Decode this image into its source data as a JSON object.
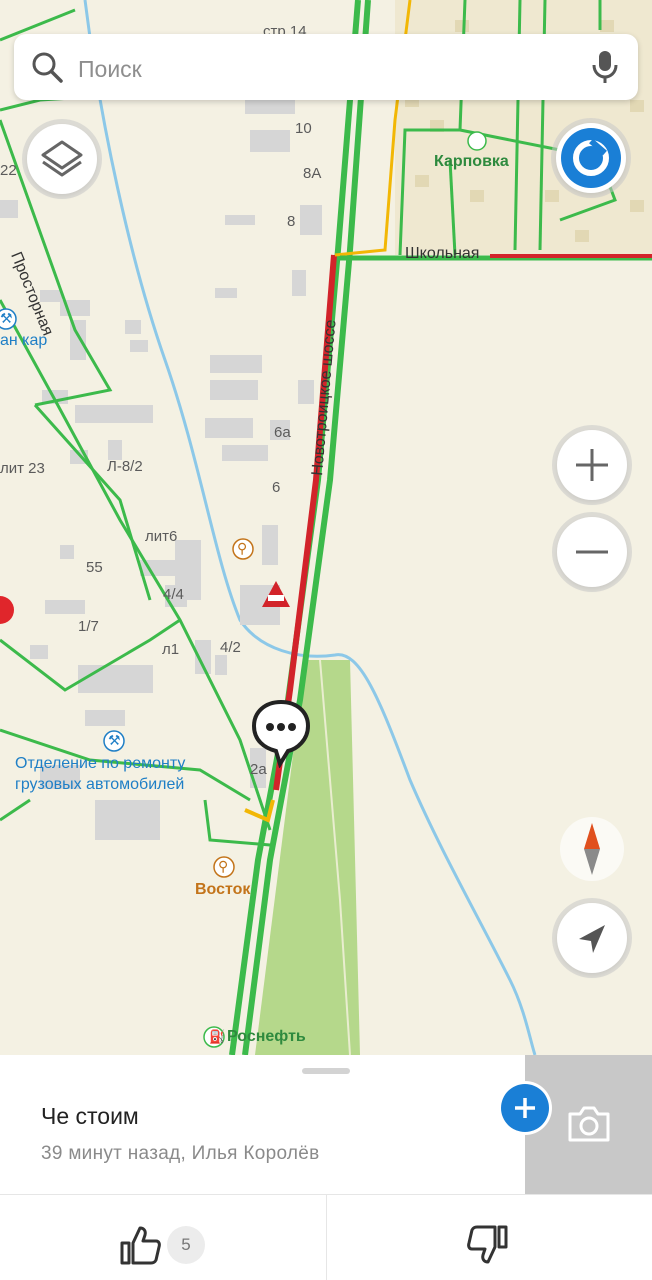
{
  "search": {
    "placeholder": "Поиск"
  },
  "map": {
    "labels": {
      "str14": "стр 14",
      "b10": "10",
      "b8a": "8А",
      "b8": "8",
      "b22": "22",
      "prostornaya": "Просторная",
      "karpovka": "Карповка",
      "shkolnaya": "Школьная",
      "novotroitskoe": "Новотроицкое шоссе",
      "pan_kar": "ан кар",
      "b6a": "6а",
      "b6": "6",
      "lit23": "лит 23",
      "l82": "Л-8/2",
      "lit6": "лит6",
      "b55": "55",
      "b44": "4/4",
      "b17": "1/7",
      "l1": "л1",
      "b42": "4/2",
      "b2a": "2а",
      "repair_line1": "Отделение по ремонту",
      "repair_line2": "грузовых автомобилей",
      "vostok": "Восток",
      "rosneft": "Роснефть"
    }
  },
  "colors": {
    "traffic_free": "#3cba4b",
    "traffic_jam": "#d2232a",
    "traffic_slow": "#f2b705",
    "accent": "#1a7fd6"
  },
  "post": {
    "title": "Че стоим",
    "meta": "39 минут назад, Илья Королёв",
    "likes": "5"
  }
}
